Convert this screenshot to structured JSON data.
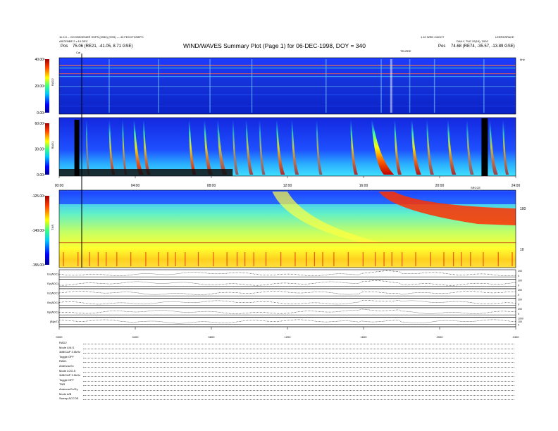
{
  "header": {
    "title": "WIND/WAVES Summary Plot (Page 1) for 06-DEC-1998, DOY = 340",
    "top_left_line1": "11.0.0 -- GCOSEGENER SSPS (0930) (SSS) --- 43 FECCFGSEPC",
    "top_left_line2": "ASCENBE 2 x 10 DEC",
    "pos_left_label": "Pos",
    "pos_left_value": "75.06 (RE21, -41.05, 8.71 GSE)",
    "top_right_line1": "1.10 WED 24/OCT",
    "top_right_line1b": "LEERDSPACE",
    "top_right_line2": "DAILY, TUE 29(15), 2002",
    "pos_right_label": "Pos",
    "pos_right_value": "74.68 (RE74, -35.57, -13.89 GSE)",
    "cal_label": "Cal",
    "marker_tr": "TELREE",
    "marker_khz": "kHz",
    "marker_mid": "SRCCE"
  },
  "chart_data": [
    {
      "type": "heatmap",
      "name_left": "RAD2",
      "colorbar_ticks": [
        "0.00",
        "20.00",
        "40.00"
      ],
      "colorbar_range": [
        0,
        40
      ],
      "x_range_hours": [
        0,
        24
      ]
    },
    {
      "type": "heatmap",
      "name_left": "RAD1",
      "colorbar_ticks": [
        "0.00",
        "30.00",
        "60.00"
      ],
      "colorbar_range": [
        0,
        60
      ],
      "x_ticks": [
        "00:00",
        "04:00",
        "08:00",
        "12:00",
        "16:00",
        "20:00",
        "24:00"
      ],
      "x_range_hours": [
        0,
        24
      ]
    },
    {
      "type": "heatmap",
      "name_left": "TNR",
      "colorbar_ticks": [
        "-155.00",
        "-140.00",
        "-125.00"
      ],
      "colorbar_range": [
        -155,
        -125
      ],
      "right_axis_ticks": [
        "100",
        "10"
      ],
      "x_range_hours": [
        0,
        24
      ]
    },
    {
      "type": "line",
      "series": [
        {
          "name": "Ex(ADC)",
          "right_ticks": [
            "200",
            "0"
          ]
        },
        {
          "name": "Ey(ADC)",
          "right_ticks": [
            "200",
            "0"
          ]
        },
        {
          "name": "Ez(ADC)",
          "right_ticks": [
            "200",
            "0"
          ]
        },
        {
          "name": "Bx(ADC)",
          "right_ticks": [
            "200",
            "0"
          ]
        },
        {
          "name": "By(ADC)",
          "right_ticks": [
            "200",
            "0"
          ]
        },
        {
          "name": "|B|(nT)",
          "right_ticks": [
            "1000",
            "100",
            "0"
          ]
        }
      ],
      "x_ticks": [
        "0000",
        "0400",
        "0800",
        "1200",
        "1600",
        "2000",
        "2400"
      ],
      "x_range_hours": [
        0,
        24
      ]
    }
  ],
  "footer": {
    "lines": [
      "RAD2",
      "Mode      LIN.S",
      "3dB/CAP   3.5kHz",
      "Toggle    OFF",
      "RAD1",
      "Antenna   Ex",
      "Mode      LOG.S",
      "3dB/CAP   3.5kHz",
      "Toggle    OFF",
      "TNR",
      "Antenna   Ex/Ey",
      "Mode      A/B",
      "Sweep     ACCOS"
    ]
  }
}
